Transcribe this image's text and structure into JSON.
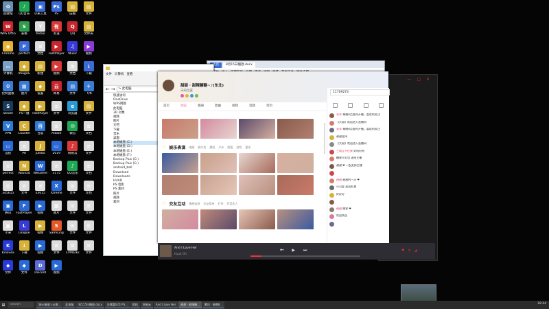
{
  "desktop": {
    "icons": [
      {
        "label": "回收站",
        "color": "#6b8fb3",
        "glyph": "♻"
      },
      {
        "label": "QQ音乐",
        "color": "#1fa855",
        "glyph": "♪"
      },
      {
        "label": "小米工具",
        "color": "#3a6bd6",
        "glyph": "▣"
      },
      {
        "label": "PS",
        "color": "#3a6bd6",
        "glyph": "Ps"
      },
      {
        "label": "压缩",
        "color": "#d6b23a",
        "glyph": "▤"
      },
      {
        "label": "文件",
        "color": "#d6b23a",
        "glyph": "▤"
      },
      {
        "label": "WPS Office",
        "color": "#c8262f",
        "glyph": "W"
      },
      {
        "label": "表格",
        "color": "#2f9e4f",
        "glyph": "S"
      },
      {
        "label": "Yodao",
        "color": "#ddd",
        "glyph": "Y"
      },
      {
        "label": "有道",
        "color": "#d83a3a",
        "glyph": "有"
      },
      {
        "label": "QQ",
        "color": "#c8262f",
        "glyph": "Q"
      },
      {
        "label": "文件夹",
        "color": "#d6b23a",
        "glyph": "▤"
      },
      {
        "label": "Chrome",
        "color": "#e6b22f",
        "glyph": "◉"
      },
      {
        "label": "perfect",
        "color": "#3a6bd6",
        "glyph": "P"
      },
      {
        "label": "文档",
        "color": "#ddd",
        "glyph": "≡"
      },
      {
        "label": "FastPlayer",
        "color": "#c8262f",
        "glyph": "▶"
      },
      {
        "label": "Music",
        "color": "#3a3ad6",
        "glyph": "♫"
      },
      {
        "label": "视频",
        "color": "#8a3ad6",
        "glyph": "▶"
      },
      {
        "label": "计算机",
        "color": "#7aa0c8",
        "glyph": "▭"
      },
      {
        "label": "ImageG",
        "color": "#d6b23a",
        "glyph": "◆"
      },
      {
        "label": "新建",
        "color": "#d6b23a",
        "glyph": "▤"
      },
      {
        "label": "视频",
        "color": "#d83a3a",
        "glyph": "▶"
      },
      {
        "label": "文档",
        "color": "#ddd",
        "glyph": "≡"
      },
      {
        "label": "下载",
        "color": "#3a6bd6",
        "glyph": "↓"
      },
      {
        "label": "控制面板",
        "color": "#3a7bd6",
        "glyph": "⚙"
      },
      {
        "label": "图片",
        "color": "#3a7bd6",
        "glyph": "▦"
      },
      {
        "label": "设置",
        "color": "#d6b23a",
        "glyph": "◆"
      },
      {
        "label": "网易",
        "color": "#c8262f",
        "glyph": "云"
      },
      {
        "label": "文件",
        "color": "#3a7bd6",
        "glyph": "▤"
      },
      {
        "label": "飞书",
        "color": "#3a7bd6",
        "glyph": "✈"
      },
      {
        "label": "Steam",
        "color": "#1a3a5a",
        "glyph": "S"
      },
      {
        "label": "PS一键",
        "color": "#d6b23a",
        "glyph": "◆"
      },
      {
        "label": "FastPlayer",
        "color": "#d6b23a",
        "glyph": "▶"
      },
      {
        "label": "文件",
        "color": "#ddd",
        "glyph": "≡"
      },
      {
        "label": "浏览器",
        "color": "#2a9ad6",
        "glyph": "e"
      },
      {
        "label": "文件",
        "color": "#d6b23a",
        "glyph": "▤"
      },
      {
        "label": "VPN",
        "color": "#2a7ad6",
        "glyph": "V"
      },
      {
        "label": "Counter",
        "color": "#d6b23a",
        "glyph": "C"
      },
      {
        "label": "百度",
        "color": "#2a7ad6",
        "glyph": "百"
      },
      {
        "label": "Adobe",
        "color": "#ddd",
        "glyph": "≡"
      },
      {
        "label": "微信",
        "color": "#1fa855",
        "glyph": "✉"
      },
      {
        "label": "文档",
        "color": "#ddd",
        "glyph": "≡"
      },
      {
        "label": "远程",
        "color": "#2a6ad6",
        "glyph": "▭"
      },
      {
        "label": "PR",
        "color": "#ddd",
        "glyph": "≡"
      },
      {
        "label": "jumbo",
        "color": "#d6b23a",
        "glyph": "J"
      },
      {
        "label": "2019",
        "color": "#2a6ad6",
        "glyph": "▭"
      },
      {
        "label": "网易云",
        "color": "#d83a3a",
        "glyph": "♪"
      },
      {
        "label": "文件",
        "color": "#ddd",
        "glyph": "≡"
      },
      {
        "label": "perfect",
        "color": "#ddd",
        "glyph": "≡"
      },
      {
        "label": "Navicat",
        "color": "#d6b23a",
        "glyph": "N"
      },
      {
        "label": "WeGame",
        "color": "#2a6ad6",
        "glyph": "W"
      },
      {
        "label": "3175",
        "color": "#ddd",
        "glyph": "≡"
      },
      {
        "label": "QQ音乐",
        "color": "#1fa855",
        "glyph": "♪"
      },
      {
        "label": "文档",
        "color": "#ddd",
        "glyph": "≡"
      },
      {
        "label": "345615",
        "color": "#ddd",
        "glyph": "≡"
      },
      {
        "label": "文件",
        "color": "#ddd",
        "glyph": "≡"
      },
      {
        "label": "x3615",
        "color": "#ddd",
        "glyph": "≡"
      },
      {
        "label": "Xtreme",
        "color": "#2a6ad6",
        "glyph": "X"
      },
      {
        "label": "文件",
        "color": "#ddd",
        "glyph": "≡"
      },
      {
        "label": "文档",
        "color": "#ddd",
        "glyph": "≡"
      },
      {
        "label": "腾讯",
        "color": "#2a6ad6",
        "glyph": "▣"
      },
      {
        "label": "FastPlayer",
        "color": "#2a6ad6",
        "glyph": "F"
      },
      {
        "label": "视频",
        "color": "#2a6ad6",
        "glyph": "▶"
      },
      {
        "label": "图片",
        "color": "#ddd",
        "glyph": "▦"
      },
      {
        "label": "文件",
        "color": "#ddd",
        "glyph": "≡"
      },
      {
        "label": "文件",
        "color": "#ddd",
        "glyph": "≡"
      },
      {
        "label": "小米",
        "color": "#ddd",
        "glyph": "▣"
      },
      {
        "label": "League",
        "color": "#3a3ad6",
        "glyph": "L"
      },
      {
        "label": "视频",
        "color": "#d6b23a",
        "glyph": "▶"
      },
      {
        "label": "Samsung",
        "color": "#e65a2a",
        "glyph": "S"
      },
      {
        "label": "文件",
        "color": "#ddd",
        "glyph": "≡"
      },
      {
        "label": "文件",
        "color": "#ddd",
        "glyph": "≡"
      },
      {
        "label": "Kinovea",
        "color": "#2a3ad6",
        "glyph": "K"
      },
      {
        "label": "下载",
        "color": "#d6b23a",
        "glyph": "↓"
      },
      {
        "label": "视频",
        "color": "#2a6ad6",
        "glyph": "▶"
      },
      {
        "label": "文件",
        "color": "#ddd",
        "glyph": "≡"
      },
      {
        "label": "CVMarks",
        "color": "#ddd",
        "glyph": "≡"
      },
      {
        "label": "文件",
        "color": "#ddd",
        "glyph": "≡"
      },
      {
        "label": "文件",
        "color": "#2a3ad6",
        "glyph": "◆"
      },
      {
        "label": "文件",
        "color": "#2a6ad6",
        "glyph": "◆"
      },
      {
        "label": "Discord",
        "color": "#5a6ad6",
        "glyph": "D"
      },
      {
        "label": "视频",
        "color": "#2a6ad6",
        "glyph": "▶"
      }
    ]
  },
  "explorer": {
    "address": "> 此电脑",
    "ribbon": [
      "文件",
      "计算机",
      "查看"
    ],
    "tree": [
      "快速访问",
      "OneDrive",
      "WPS网盘",
      "此电脑",
      "3D 对象",
      "视频",
      "图片",
      "文档",
      "下载",
      "音乐",
      "桌面",
      "本地磁盘 (C:)",
      "本地磁盘 (D:)",
      "本地磁盘 (E:)",
      "本地磁盘 (F:)",
      "Backup Plus (G:)",
      "Backup Plus (G:)",
      "android_ball",
      "Download",
      "Downloads",
      "HUAD",
      "PS 电影",
      "PS 素材",
      "照片",
      "视频",
      "素材"
    ],
    "selected_index": 11
  },
  "browser": {
    "tabs": [
      "主页",
      "8月15日播放.docx"
    ],
    "toolbar": [
      "开始",
      "插入",
      "页面布局",
      "引用",
      "审阅",
      "视图",
      "章节",
      "开发工具",
      "特色应用"
    ]
  },
  "app": {
    "name": "甜甜 · 甜辣糖糖~♪(东北)",
    "sub": "未知位置",
    "nav": [
      "首页",
      "动态",
      "相册",
      "歌曲",
      "视频",
      "话题",
      "资料"
    ],
    "active_nav": 1,
    "sections": [
      {
        "title": "娱乐表演",
        "tags": [
          "唱歌",
          "脱口秀",
          "舞蹈",
          "户外",
          "颜值",
          "游戏",
          "更多"
        ]
      },
      {
        "title": "交友互动",
        "tags": [
          "情感连线",
          "交友相亲",
          "扩列",
          "声音恋人"
        ]
      }
    ],
    "thumb_captions": [
      "",
      "",
      "",
      "",
      "甜美 小甜甜",
      "雷雷 女神的美",
      "",
      "",
      "可爱猫",
      "",
      "",
      "",
      "",
      "",
      "",
      ""
    ]
  },
  "chat": {
    "search": "11709273",
    "messages": [
      {
        "user": "菲菲",
        "text": "每晚8点准时开播，喜欢的关注",
        "color": "#8a5a4a"
      },
      {
        "user": "",
        "text": "【大叔】欢迎进入直播间",
        "color": "#d87a6a"
      },
      {
        "user": "菲菲",
        "text": "每晚8点准时开播，喜欢的关注",
        "color": "#6a6a8a"
      },
      {
        "user": "",
        "text": "谢谢支持",
        "color": "#d6b23a"
      },
      {
        "user": "",
        "text": "【大叔】欢迎进入直播间",
        "color": "#8a8a8a"
      },
      {
        "user": "三角互不往来",
        "text": "好听好听",
        "color": "#c84a4a"
      },
      {
        "user": "",
        "text": "糖果大礼包 送给主播",
        "color": "#d87a6a"
      },
      {
        "user": "",
        "text": "谢谢 ❤ 一起支持主播",
        "color": "#7a5a4a"
      },
      {
        "user": "",
        "text": "",
        "color": "#c84a4a"
      },
      {
        "user": "甜甜",
        "text": "甜甜的一天 ❤",
        "color": "#d87a6a"
      },
      {
        "user": "",
        "text": "小可爱 送出礼物",
        "color": "#6a6a6a"
      },
      {
        "user": "",
        "text": "好好好",
        "color": "#d6b23a"
      },
      {
        "user": "",
        "text": "",
        "color": "#8a5a4a"
      },
      {
        "user": "甜甜",
        "text": "晚安 ❤",
        "color": "#8a7a6a"
      },
      {
        "user": "",
        "text": "欢迎欢迎",
        "color": "#d87a9a"
      },
      {
        "user": "",
        "text": "",
        "color": "#6a6a8a"
      }
    ]
  },
  "player": {
    "song": "And I Love Her",
    "artist": "Hyuk Oh",
    "progress": 0.1,
    "controls": [
      "⏮",
      "▶",
      "⏭"
    ]
  },
  "taskbar": {
    "search": "search",
    "items": [
      "演示(精彩)-从哪...",
      "此电脑",
      "8月15日播放.docx",
      "金属嘉年华 PS...",
      "相机",
      "网易云",
      "And I Love Her",
      "甜甜 · 甜辣糖...",
      "腾讯 · 每晚8..."
    ],
    "active_index": 7,
    "tray": "18:44"
  },
  "colors": {
    "accent": "#e65a8d",
    "player_bg": "#2d2d33",
    "brand": "#3c6fd6"
  }
}
